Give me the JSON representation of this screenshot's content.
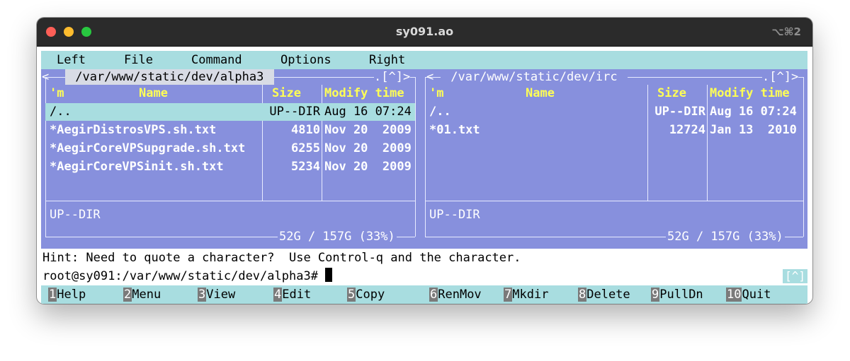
{
  "window": {
    "title": "sy091.ao",
    "shortcut": "⌥⌘2"
  },
  "menubar": [
    "Left",
    "File",
    "Command",
    "Options",
    "Right"
  ],
  "left_panel": {
    "path": " /var/www/static/dev/alpha3 ",
    "corner": ".[^]>",
    "columns": {
      "sort": "'m",
      "name": "Name",
      "size": "Size",
      "time": "Modify time"
    },
    "rows": [
      {
        "name": "/..",
        "size": "UP--DIR",
        "time": "Aug 16 07:24"
      },
      {
        "name": "*AegirDistrosVPS.sh.txt",
        "size": "4810",
        "time": "Nov 20  2009"
      },
      {
        "name": "*AegirCoreVPSupgrade.sh.txt",
        "size": "6255",
        "time": "Nov 20  2009"
      },
      {
        "name": "*AegirCoreVPSinit.sh.txt",
        "size": "5234",
        "time": "Nov 20  2009"
      }
    ],
    "status": "UP--DIR",
    "usage": "52G / 157G (33%)"
  },
  "right_panel": {
    "path": " /var/www/static/dev/irc ",
    "corner": ".[^]>",
    "columns": {
      "sort": "'m",
      "name": "Name",
      "size": "Size",
      "time": "Modify time"
    },
    "rows": [
      {
        "name": "/..",
        "size": "UP--DIR",
        "time": "Aug 16 07:24"
      },
      {
        "name": "*01.txt",
        "size": "12724",
        "time": "Jan 13  2010"
      }
    ],
    "status": "UP--DIR",
    "usage": "52G / 157G (33%)"
  },
  "hint": "Hint: Need to quote a character?  Use Control-q and the character.",
  "prompt": "root@sy091:/var/www/static/dev/alpha3# ",
  "subshell_button": "[^]",
  "function_keys": [
    {
      "num": "1",
      "label": "Help"
    },
    {
      "num": "2",
      "label": "Menu"
    },
    {
      "num": "3",
      "label": "View"
    },
    {
      "num": "4",
      "label": "Edit"
    },
    {
      "num": "5",
      "label": "Copy"
    },
    {
      "num": "6",
      "label": "RenMov"
    },
    {
      "num": "7",
      "label": "Mkdir"
    },
    {
      "num": "8",
      "label": "Delete"
    },
    {
      "num": "9",
      "label": "PullDn"
    },
    {
      "num": "10",
      "label": "Quit"
    }
  ]
}
